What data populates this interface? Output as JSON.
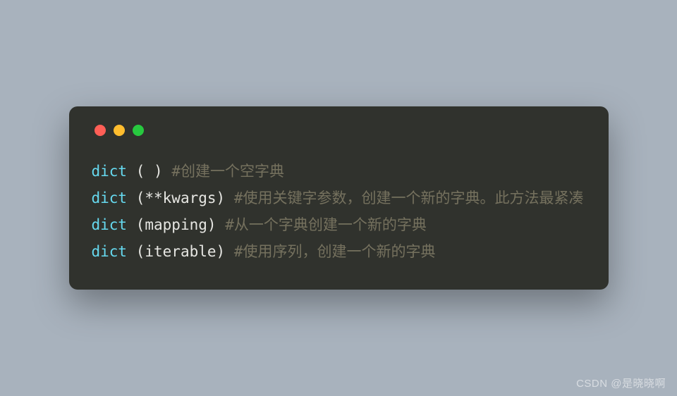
{
  "code": {
    "lines": [
      {
        "keyword": "dict",
        "paren_open": " ( ",
        "arg": "",
        "paren_close": ") ",
        "spacer": "  ",
        "comment": "#创建一个空字典"
      },
      {
        "keyword": "dict",
        "paren_open": " (",
        "arg": "**kwargs",
        "paren_close": ") ",
        "spacer": "",
        "comment": "#使用关键字参数，创建一个新的字典。此方法最紧凑"
      },
      {
        "keyword": "dict",
        "paren_open": " (",
        "arg": "mapping",
        "paren_close": ") ",
        "spacer": "",
        "comment": "#从一个字典创建一个新的字典"
      },
      {
        "keyword": "dict",
        "paren_open": " (",
        "arg": "iterable",
        "paren_close": ") ",
        "spacer": "",
        "comment": "#使用序列，创建一个新的字典"
      }
    ]
  },
  "watermark": "CSDN @是晓晓啊"
}
